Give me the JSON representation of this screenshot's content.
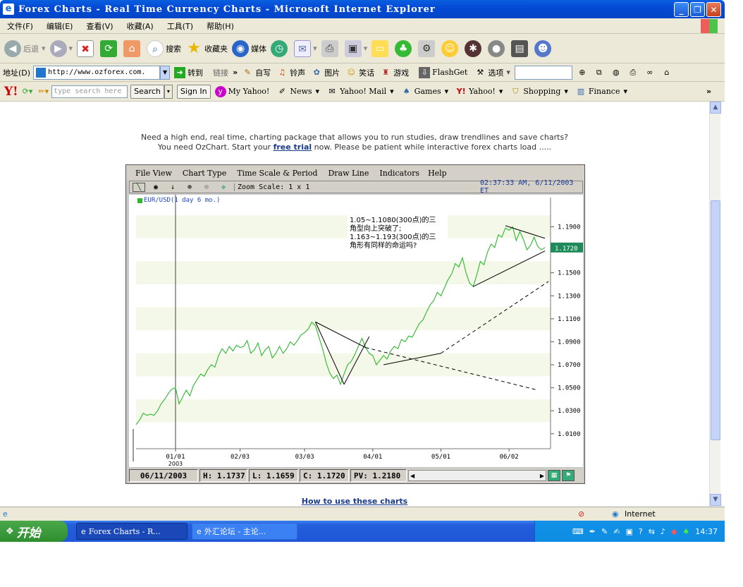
{
  "window": {
    "title": "Forex Charts - Real Time Currency Charts - Microsoft Internet Explorer",
    "min": "_",
    "max": "❐",
    "close": "✕"
  },
  "menu": [
    "文件(F)",
    "编辑(E)",
    "查看(V)",
    "收藏(A)",
    "工具(T)",
    "帮助(H)"
  ],
  "toolbar": {
    "back": "后退",
    "search": "搜索",
    "favorites": "收藏夹",
    "media": "媒体"
  },
  "address": {
    "label": "地址(D)",
    "url": "http://www.ozforex.com.",
    "go": "转到",
    "links": "链接",
    "link_items": [
      "自写",
      "铃声",
      "图片",
      "笑话",
      "游戏"
    ],
    "flashget": "FlashGet",
    "options": "选项"
  },
  "yahoo": {
    "search_placeholder": "type search here",
    "search_btn": "Search",
    "sign_in": "Sign In",
    "items": [
      "My Yahoo!",
      "News",
      "Yahoo! Mail",
      "Games",
      "Yahoo!",
      "Shopping",
      "Finance"
    ]
  },
  "page": {
    "promo_line1": "Need a high end, real time, charting package that allows you to run studies, draw trendlines and save charts?",
    "promo_pre": "You need OzChart. Start your ",
    "promo_link": "free trial",
    "promo_post": " now.  Please be patient while interactive forex charts load .....",
    "howto": "How to use these charts"
  },
  "applet": {
    "menu": [
      "File View",
      "Chart Type",
      "Time Scale & Period",
      "Draw Line",
      "Indicators",
      "Help"
    ],
    "zoom": "Zoom Scale: 1 x 1",
    "timestamp": "02:37:33 AM, 6/11/2003 ET",
    "legend": "EUR/USD(1 day  6 mo.)",
    "annotation": [
      "1.05~1.1080(300点)的三",
      "角型向上突破了;",
      "1.163~1.193(300点)的三",
      "角形有同样的命运吗?"
    ],
    "status": {
      "date": "06/11/2003",
      "h": "H: 1.1737",
      "l": "L: 1.1659",
      "c": "C: 1.1720",
      "pv": "PV: 1.2180"
    }
  },
  "chart_data": {
    "type": "line",
    "title": "EUR/USD(1 day  6 mo.)",
    "x_tick_labels": [
      "01/01",
      "02/03",
      "03/03",
      "04/01",
      "05/01",
      "06/02"
    ],
    "x_tick_sub": "2003",
    "y_tick_labels": [
      "1.1900",
      "1.1700",
      "1.1500",
      "1.1300",
      "1.1100",
      "1.0900",
      "1.0700",
      "1.0500",
      "1.0300",
      "1.0100"
    ],
    "ylim": [
      0.997,
      1.213
    ],
    "last_value": "1.1720",
    "series": [
      {
        "values": [
          1.018,
          1.022,
          1.028,
          1.026,
          1.027,
          1.026,
          1.03,
          1.036,
          1.04,
          1.045,
          1.049,
          1.05,
          1.036,
          1.042,
          1.048,
          1.043,
          1.052,
          1.057,
          1.062,
          1.06,
          1.066,
          1.07,
          1.068,
          1.078,
          1.084,
          1.08,
          1.086,
          1.082,
          1.087,
          1.085,
          1.086,
          1.091,
          1.08,
          1.083,
          1.089,
          1.078,
          1.083,
          1.086,
          1.076,
          1.08,
          1.086,
          1.08,
          1.084,
          1.09,
          1.087,
          1.091,
          1.096,
          1.098,
          1.101,
          1.107,
          1.104,
          1.094,
          1.084,
          1.072,
          1.063,
          1.058,
          1.061,
          1.053,
          1.062,
          1.07,
          1.073,
          1.079,
          1.086,
          1.093,
          1.085,
          1.08,
          1.078,
          1.07,
          1.074,
          1.078,
          1.075,
          1.082,
          1.086,
          1.084,
          1.092,
          1.09,
          1.095,
          1.094,
          1.1,
          1.106,
          1.109,
          1.116,
          1.122,
          1.126,
          1.133,
          1.13,
          1.137,
          1.144,
          1.149,
          1.158,
          1.155,
          1.163,
          1.15,
          1.141,
          1.138,
          1.148,
          1.16,
          1.157,
          1.168,
          1.175,
          1.172,
          1.183,
          1.181,
          1.189,
          1.187,
          1.19,
          1.178,
          1.186,
          1.179,
          1.17,
          1.174,
          1.181,
          1.173,
          1.17,
          1.172
        ]
      }
    ],
    "trendlines": [
      {
        "style": "solid",
        "points": [
          [
            50,
            1.1073
          ],
          [
            58,
            1.053
          ]
        ]
      },
      {
        "style": "solid",
        "points": [
          [
            58,
            1.053
          ],
          [
            65,
            1.0945
          ]
        ]
      },
      {
        "style": "solid",
        "points": [
          [
            50,
            1.1073
          ],
          [
            64,
            1.085
          ]
        ]
      },
      {
        "style": "dashed",
        "points": [
          [
            64,
            1.085
          ],
          [
            112,
            1.048
          ]
        ]
      },
      {
        "style": "solid",
        "points": [
          [
            69,
            1.07
          ],
          [
            85,
            1.08
          ]
        ]
      },
      {
        "style": "dashed",
        "points": [
          [
            85,
            1.08
          ],
          [
            115,
            1.1425
          ]
        ]
      },
      {
        "style": "solid",
        "points": [
          [
            94,
            1.138
          ],
          [
            114,
            1.169
          ]
        ]
      },
      {
        "style": "solid",
        "points": [
          [
            103,
            1.191
          ],
          [
            114,
            1.18
          ]
        ]
      }
    ]
  },
  "status_bar": {
    "zone": "Internet"
  },
  "taskbar": {
    "start": "开始",
    "tasks": [
      "Forex Charts - R...",
      "外汇论坛 - 主论..."
    ],
    "clock": "14:37"
  }
}
